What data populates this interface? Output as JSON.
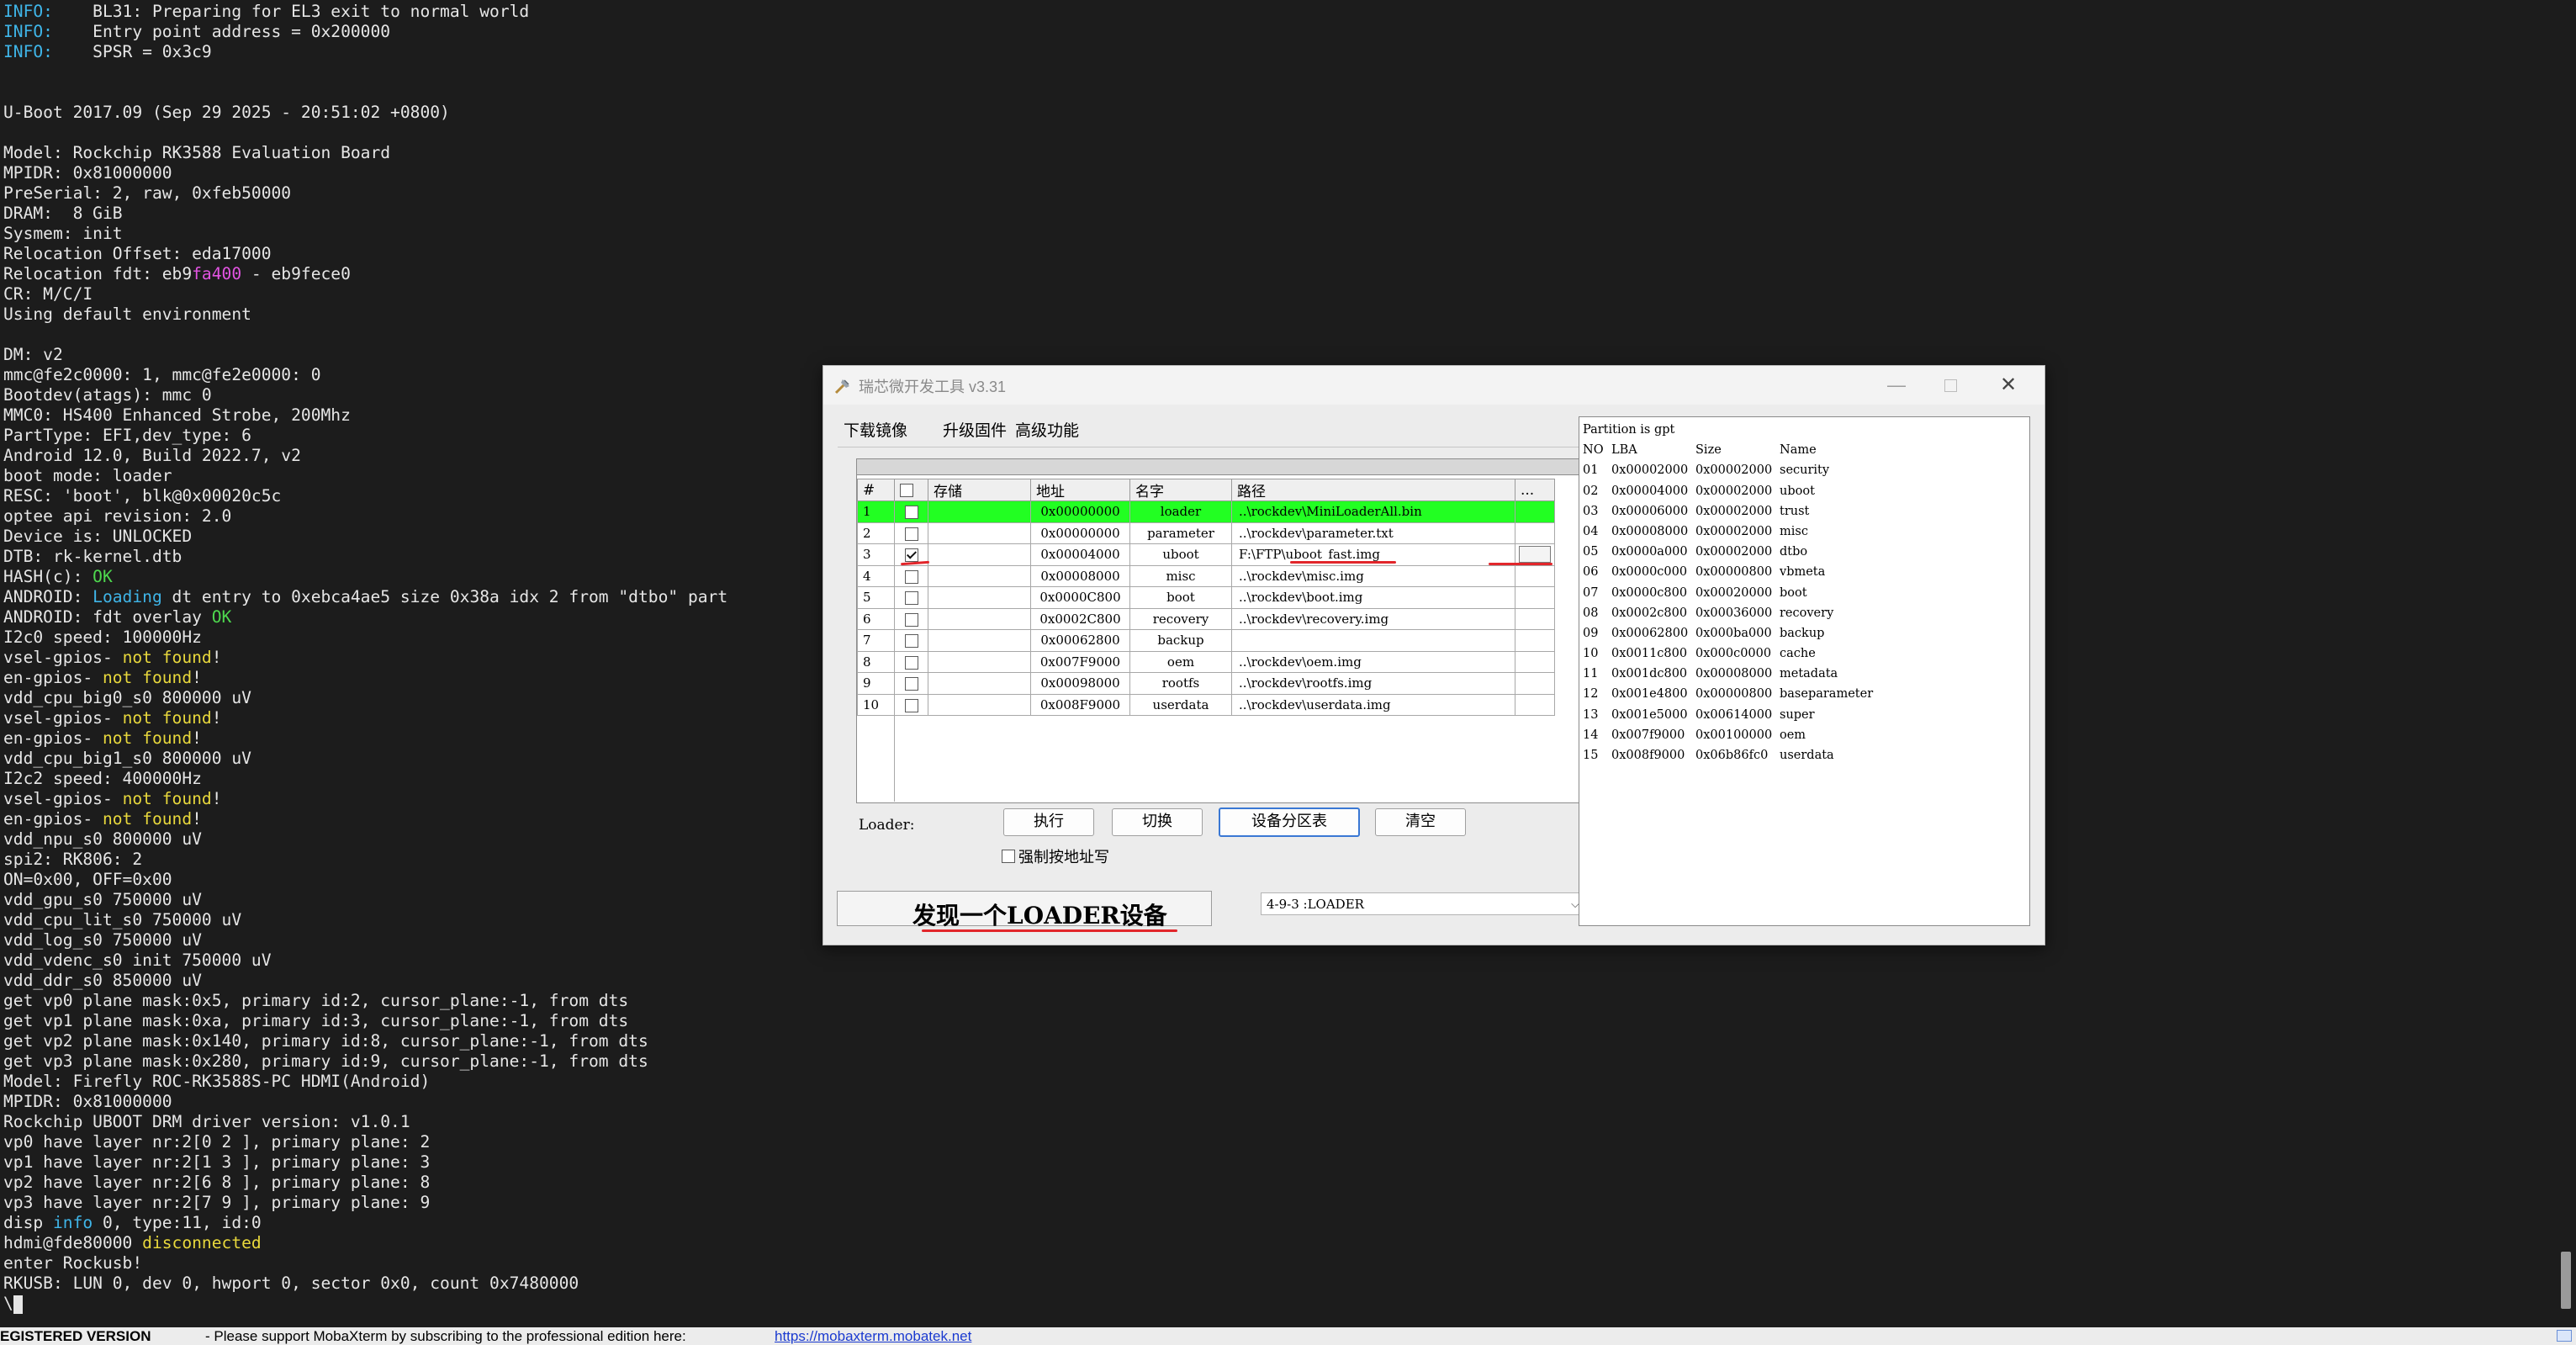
{
  "terminal": {
    "lines": [
      [
        {
          "t": "INFO:",
          "c": "cyan"
        },
        {
          "t": "    BL31: Preparing for EL3 exit to normal world",
          "c": "white"
        }
      ],
      [
        {
          "t": "INFO:",
          "c": "cyan"
        },
        {
          "t": "    Entry point address = 0x200000",
          "c": "white"
        }
      ],
      [
        {
          "t": "INFO:",
          "c": "cyan"
        },
        {
          "t": "    SPSR = 0x3c9",
          "c": "white"
        }
      ],
      [],
      [],
      [
        {
          "t": "U-Boot 2017.09 (Sep 29 2025 - 20:51:02 +0800)",
          "c": "white"
        }
      ],
      [],
      [
        {
          "t": "Model: Rockchip RK3588 Evaluation Board",
          "c": "white"
        }
      ],
      [
        {
          "t": "MPIDR: 0x81000000",
          "c": "white"
        }
      ],
      [
        {
          "t": "PreSerial: 2, raw, 0xfeb50000",
          "c": "white"
        }
      ],
      [
        {
          "t": "DRAM:  8 GiB",
          "c": "white"
        }
      ],
      [
        {
          "t": "Sysmem: init",
          "c": "white"
        }
      ],
      [
        {
          "t": "Relocation Offset: eda17000",
          "c": "white"
        }
      ],
      [
        {
          "t": "Relocation fdt: eb9",
          "c": "white"
        },
        {
          "t": "fa400",
          "c": "magenta"
        },
        {
          "t": " - eb9fece0",
          "c": "white"
        }
      ],
      [
        {
          "t": "CR: M/C/I",
          "c": "white"
        }
      ],
      [
        {
          "t": "Using default environment",
          "c": "white"
        }
      ],
      [],
      [
        {
          "t": "DM: v2",
          "c": "white"
        }
      ],
      [
        {
          "t": "mmc@fe2c0000: 1, mmc@fe2e0000: 0",
          "c": "white"
        }
      ],
      [
        {
          "t": "Bootdev(atags): mmc 0",
          "c": "white"
        }
      ],
      [
        {
          "t": "MMC0: HS400 Enhanced Strobe, 200Mhz",
          "c": "white"
        }
      ],
      [
        {
          "t": "PartType: EFI,dev_type: 6",
          "c": "white"
        }
      ],
      [
        {
          "t": "Android 12.0, Build 2022.7, v2",
          "c": "white"
        }
      ],
      [
        {
          "t": "boot mode: loader",
          "c": "white"
        }
      ],
      [
        {
          "t": "RESC: 'boot', blk@0x00020c5c",
          "c": "white"
        }
      ],
      [
        {
          "t": "optee api revision: 2.0",
          "c": "white"
        }
      ],
      [
        {
          "t": "Device is: UNLOCKED",
          "c": "white"
        }
      ],
      [
        {
          "t": "DTB: rk-kernel.dtb",
          "c": "white"
        }
      ],
      [
        {
          "t": "HASH(c): ",
          "c": "white"
        },
        {
          "t": "OK",
          "c": "green"
        }
      ],
      [
        {
          "t": "ANDROID: ",
          "c": "white"
        },
        {
          "t": "Loading",
          "c": "cyan"
        },
        {
          "t": " dt entry to 0xebca4ae5 size 0x38a idx 2 from \"dtbo\" part",
          "c": "white"
        }
      ],
      [
        {
          "t": "ANDROID: fdt overlay ",
          "c": "white"
        },
        {
          "t": "OK",
          "c": "green"
        }
      ],
      [
        {
          "t": "I2c0 speed: 100000Hz",
          "c": "white"
        }
      ],
      [
        {
          "t": "vsel-gpios- ",
          "c": "white"
        },
        {
          "t": "not found",
          "c": "yellow"
        },
        {
          "t": "!",
          "c": "white"
        }
      ],
      [
        {
          "t": "en-gpios- ",
          "c": "white"
        },
        {
          "t": "not found",
          "c": "yellow"
        },
        {
          "t": "!",
          "c": "white"
        }
      ],
      [
        {
          "t": "vdd_cpu_big0_s0 800000 uV",
          "c": "white"
        }
      ],
      [
        {
          "t": "vsel-gpios- ",
          "c": "white"
        },
        {
          "t": "not found",
          "c": "yellow"
        },
        {
          "t": "!",
          "c": "white"
        }
      ],
      [
        {
          "t": "en-gpios- ",
          "c": "white"
        },
        {
          "t": "not found",
          "c": "yellow"
        },
        {
          "t": "!",
          "c": "white"
        }
      ],
      [
        {
          "t": "vdd_cpu_big1_s0 800000 uV",
          "c": "white"
        }
      ],
      [
        {
          "t": "I2c2 speed: 400000Hz",
          "c": "white"
        }
      ],
      [
        {
          "t": "vsel-gpios- ",
          "c": "white"
        },
        {
          "t": "not found",
          "c": "yellow"
        },
        {
          "t": "!",
          "c": "white"
        }
      ],
      [
        {
          "t": "en-gpios- ",
          "c": "white"
        },
        {
          "t": "not found",
          "c": "yellow"
        },
        {
          "t": "!",
          "c": "white"
        }
      ],
      [
        {
          "t": "vdd_npu_s0 800000 uV",
          "c": "white"
        }
      ],
      [
        {
          "t": "spi2: RK806: 2",
          "c": "white"
        }
      ],
      [
        {
          "t": "ON=0x00, OFF=0x00",
          "c": "white"
        }
      ],
      [
        {
          "t": "vdd_gpu_s0 750000 uV",
          "c": "white"
        }
      ],
      [
        {
          "t": "vdd_cpu_lit_s0 750000 uV",
          "c": "white"
        }
      ],
      [
        {
          "t": "vdd_log_s0 750000 uV",
          "c": "white"
        }
      ],
      [
        {
          "t": "vdd_vdenc_s0 init 750000 uV",
          "c": "white"
        }
      ],
      [
        {
          "t": "vdd_ddr_s0 850000 uV",
          "c": "white"
        }
      ],
      [
        {
          "t": "get vp0 plane mask:0x5, primary id:2, cursor_plane:-1, from dts",
          "c": "white"
        }
      ],
      [
        {
          "t": "get vp1 plane mask:0xa, primary id:3, cursor_plane:-1, from dts",
          "c": "white"
        }
      ],
      [
        {
          "t": "get vp2 plane mask:0x140, primary id:8, cursor_plane:-1, from dts",
          "c": "white"
        }
      ],
      [
        {
          "t": "get vp3 plane mask:0x280, primary id:9, cursor_plane:-1, from dts",
          "c": "white"
        }
      ],
      [
        {
          "t": "Model: Firefly ROC-RK3588S-PC HDMI(Android)",
          "c": "white"
        }
      ],
      [
        {
          "t": "MPIDR: 0x81000000",
          "c": "white"
        }
      ],
      [
        {
          "t": "Rockchip UBOOT DRM driver version: v1.0.1",
          "c": "white"
        }
      ],
      [
        {
          "t": "vp0 have layer nr:2[0 2 ], primary plane: 2",
          "c": "white"
        }
      ],
      [
        {
          "t": "vp1 have layer nr:2[1 3 ], primary plane: 3",
          "c": "white"
        }
      ],
      [
        {
          "t": "vp2 have layer nr:2[6 8 ], primary plane: 8",
          "c": "white"
        }
      ],
      [
        {
          "t": "vp3 have layer nr:2[7 9 ], primary plane: 9",
          "c": "white"
        }
      ],
      [
        {
          "t": "disp ",
          "c": "white"
        },
        {
          "t": "info",
          "c": "cyan"
        },
        {
          "t": " 0, type:11, id:0",
          "c": "white"
        }
      ],
      [
        {
          "t": "hdmi@fde80000 ",
          "c": "white"
        },
        {
          "t": "disconnected",
          "c": "yellow"
        }
      ],
      [
        {
          "t": "enter Rockusb!",
          "c": "white"
        }
      ],
      [
        {
          "t": "RKUSB: LUN 0, dev 0, hwport 0, sector 0x0, count 0x7480000",
          "c": "white"
        }
      ],
      [
        {
          "t": "\\",
          "c": "white"
        },
        {
          "t": "",
          "c": "cursor"
        }
      ]
    ]
  },
  "status_bar": {
    "text": "EGISTERED VERSION",
    "sub": "-  Please support MobaXterm by subscribing to the professional edition here:",
    "link": "https://mobaxterm.mobatek.net"
  },
  "dialog": {
    "title": "瑞芯微开发工具 v3.31",
    "tabs": [
      "下载镜像",
      "升级固件",
      "高级功能"
    ],
    "table": {
      "headers": [
        "#",
        "",
        "存储",
        "地址",
        "名字",
        "路径",
        "..."
      ],
      "rows": [
        {
          "no": "1",
          "checked": false,
          "storage": "",
          "addr": "0x00000000",
          "name": "loader",
          "path": "..\\rockdev\\MiniLoaderAll.bin",
          "highlight": true
        },
        {
          "no": "2",
          "checked": false,
          "storage": "",
          "addr": "0x00000000",
          "name": "parameter",
          "path": "..\\rockdev\\parameter.txt",
          "highlight": false
        },
        {
          "no": "3",
          "checked": true,
          "storage": "",
          "addr": "0x00004000",
          "name": "uboot",
          "path": "F:\\FTP\\uboot_fast.img",
          "highlight": false
        },
        {
          "no": "4",
          "checked": false,
          "storage": "",
          "addr": "0x00008000",
          "name": "misc",
          "path": "..\\rockdev\\misc.img",
          "highlight": false
        },
        {
          "no": "5",
          "checked": false,
          "storage": "",
          "addr": "0x0000C800",
          "name": "boot",
          "path": "..\\rockdev\\boot.img",
          "highlight": false
        },
        {
          "no": "6",
          "checked": false,
          "storage": "",
          "addr": "0x0002C800",
          "name": "recovery",
          "path": "..\\rockdev\\recovery.img",
          "highlight": false
        },
        {
          "no": "7",
          "checked": false,
          "storage": "",
          "addr": "0x00062800",
          "name": "backup",
          "path": "",
          "highlight": false
        },
        {
          "no": "8",
          "checked": false,
          "storage": "",
          "addr": "0x007F9000",
          "name": "oem",
          "path": "..\\rockdev\\oem.img",
          "highlight": false
        },
        {
          "no": "9",
          "checked": false,
          "storage": "",
          "addr": "0x00098000",
          "name": "rootfs",
          "path": "..\\rockdev\\rootfs.img",
          "highlight": false
        },
        {
          "no": "10",
          "checked": false,
          "storage": "",
          "addr": "0x008F9000",
          "name": "userdata",
          "path": "..\\rockdev\\userdata.img",
          "highlight": false
        }
      ]
    },
    "loader_label": "Loader:",
    "buttons": {
      "exec": "执行",
      "switch": "切换",
      "device_partition": "设备分区表",
      "clear": "清空"
    },
    "force_addr_label": "强制按地址写",
    "found_text": "发现一个LOADER设备",
    "device_select": "4-9-3 :LOADER",
    "partition_panel": {
      "header": "Partition is gpt",
      "columns": [
        "NO",
        "LBA",
        "Size",
        "Name"
      ],
      "rows": [
        [
          "01",
          "0x00002000",
          "0x00002000",
          "security"
        ],
        [
          "02",
          "0x00004000",
          "0x00002000",
          "uboot"
        ],
        [
          "03",
          "0x00006000",
          "0x00002000",
          "trust"
        ],
        [
          "04",
          "0x00008000",
          "0x00002000",
          "misc"
        ],
        [
          "05",
          "0x0000a000",
          "0x00002000",
          "dtbo"
        ],
        [
          "06",
          "0x0000c000",
          "0x00000800",
          "vbmeta"
        ],
        [
          "07",
          "0x0000c800",
          "0x00020000",
          "boot"
        ],
        [
          "08",
          "0x0002c800",
          "0x00036000",
          "recovery"
        ],
        [
          "09",
          "0x00062800",
          "0x000ba000",
          "backup"
        ],
        [
          "10",
          "0x0011c800",
          "0x000c0000",
          "cache"
        ],
        [
          "11",
          "0x001dc800",
          "0x00008000",
          "metadata"
        ],
        [
          "12",
          "0x001e4800",
          "0x00000800",
          "baseparameter"
        ],
        [
          "13",
          "0x001e5000",
          "0x00614000",
          "super"
        ],
        [
          "14",
          "0x007f9000",
          "0x00100000",
          "oem"
        ],
        [
          "15",
          "0x008f9000",
          "0x06b86fc0",
          "userdata"
        ]
      ]
    }
  },
  "colors": {
    "terminal_bg": "#1c1c1c",
    "info_cyan": "#3fb5e8",
    "ok_green": "#4ed84e",
    "warn_yellow": "#e8d83c",
    "highlight_row": "#22ff22",
    "annotation_red": "#e2262b"
  }
}
